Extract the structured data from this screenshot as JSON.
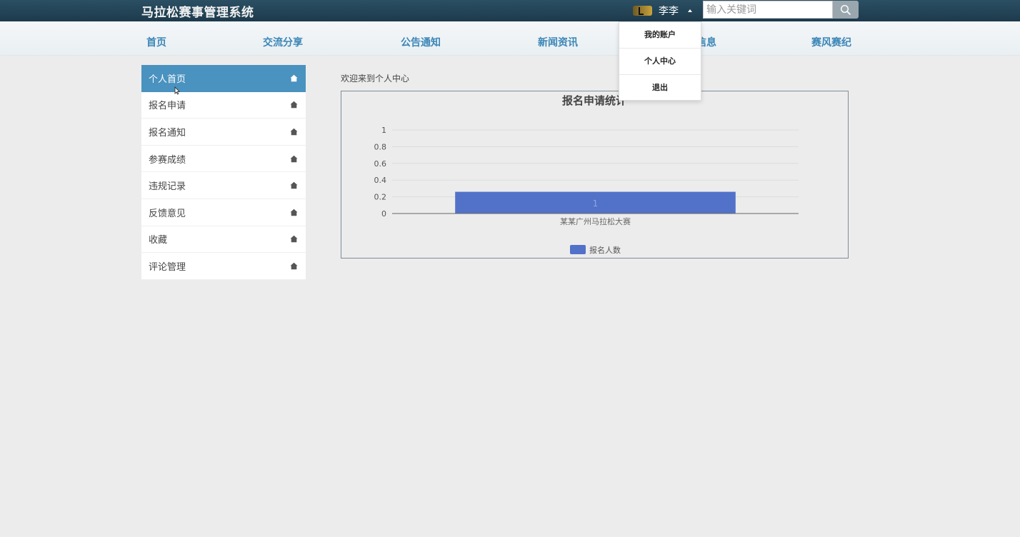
{
  "header": {
    "title": "马拉松赛事管理系统",
    "user_name": "李李",
    "search_placeholder": "输入关键词",
    "icons": {
      "search": "search-icon",
      "avatar": "avatar-icon",
      "caret": "caret-up-icon"
    }
  },
  "nav": {
    "items": [
      {
        "label": "首页"
      },
      {
        "label": "交流分享"
      },
      {
        "label": "公告通知"
      },
      {
        "label": "新闻资讯"
      },
      {
        "label": "信息"
      },
      {
        "label": "赛风赛纪"
      }
    ]
  },
  "user_menu": {
    "items": [
      {
        "label": "我的账户"
      },
      {
        "label": "个人中心"
      },
      {
        "label": "退出"
      }
    ]
  },
  "sidebar": {
    "items": [
      {
        "label": "个人首页",
        "active": true
      },
      {
        "label": "报名申请"
      },
      {
        "label": "报名通知"
      },
      {
        "label": "参赛成绩"
      },
      {
        "label": "违规记录"
      },
      {
        "label": "反馈意见"
      },
      {
        "label": "收藏"
      },
      {
        "label": "评论管理"
      }
    ],
    "icon": "home-icon"
  },
  "main": {
    "welcome": "欢迎来到个人中心"
  },
  "colors": {
    "header_bg": "#1f3d4f",
    "nav_text": "#3b86b7",
    "sidebar_active": "#4a92bf",
    "bar": "#5272c9"
  },
  "chart_data": {
    "type": "bar",
    "title": "报名申请统计",
    "categories": [
      "某某广州马拉松大赛"
    ],
    "series": [
      {
        "name": "报名人数",
        "values": [
          1
        ]
      }
    ],
    "data_labels": [
      "1"
    ],
    "y_ticks": [
      "0",
      "0.2",
      "0.4",
      "0.6",
      "0.8",
      "1"
    ],
    "ylim": [
      0,
      1
    ],
    "grid": true,
    "legend": "bottom"
  }
}
